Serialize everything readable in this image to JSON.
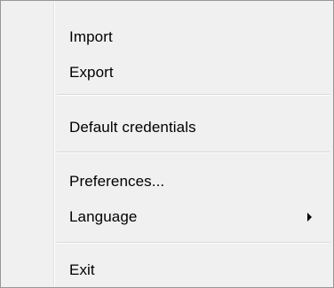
{
  "menu": {
    "items": [
      {
        "label": "Import"
      },
      {
        "label": "Export"
      },
      {
        "label": "Default credentials"
      },
      {
        "label": "Preferences..."
      },
      {
        "label": "Language",
        "submenu_icon": "submenu-arrow-icon"
      },
      {
        "label": "Exit"
      }
    ]
  }
}
